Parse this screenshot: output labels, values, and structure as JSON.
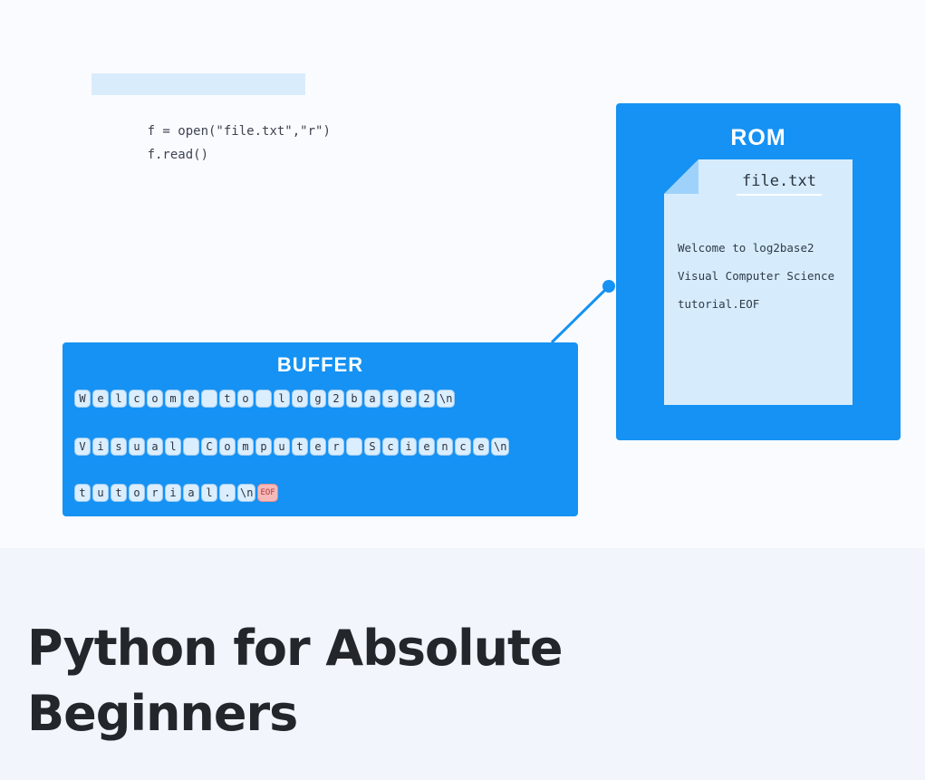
{
  "code": {
    "lines": [
      "f = open(\"file.txt\",\"r\")",
      "f.read()"
    ]
  },
  "rom": {
    "title": "ROM",
    "file_name": "file.txt",
    "file_lines": [
      "Welcome to log2base2",
      "Visual Computer Science",
      "tutorial.EOF"
    ]
  },
  "buffer": {
    "title": "BUFFER",
    "rows": [
      [
        "W",
        "e",
        "l",
        "c",
        "o",
        "m",
        "e",
        " ",
        "t",
        "o",
        " ",
        "l",
        "o",
        "g",
        "2",
        "b",
        "a",
        "s",
        "e",
        "2",
        "\\n"
      ],
      [
        "V",
        "i",
        "s",
        "u",
        "a",
        "l",
        " ",
        "C",
        "o",
        "m",
        "p",
        "u",
        "t",
        "e",
        "r",
        " ",
        "S",
        "c",
        "i",
        "e",
        "n",
        "c",
        "e",
        "\\n"
      ],
      [
        "t",
        "u",
        "t",
        "o",
        "r",
        "i",
        "a",
        "l",
        ".",
        "\\n",
        "EOF"
      ]
    ]
  },
  "colors": {
    "box_blue": "#1592f3",
    "file_paper": "#d6ecfd",
    "eof_cell": "#f6b9b9"
  },
  "page_title": {
    "line1": "Python for Absolute",
    "line2": "Beginners"
  }
}
